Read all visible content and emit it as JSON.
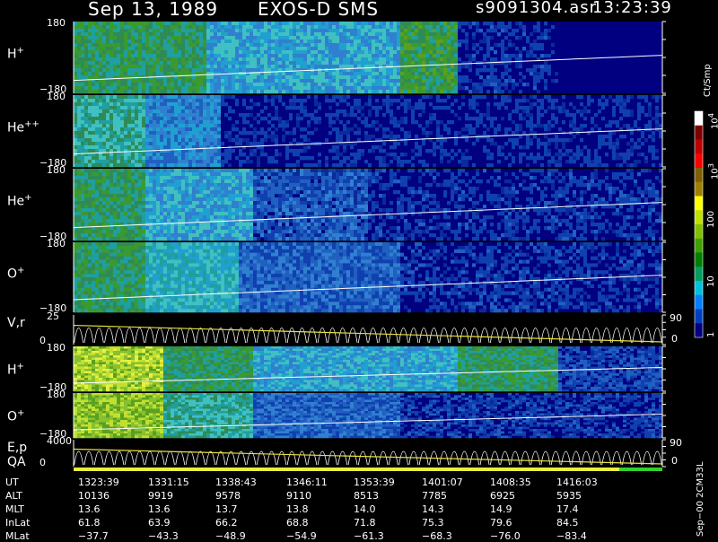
{
  "header": {
    "date": "Sep 13, 1989",
    "instrument": "EXOS-D SMS",
    "file": "s9091304.asr",
    "time": "13:23:39"
  },
  "chart_data": {
    "type": "heatmap",
    "panels": [
      {
        "label": "H",
        "charge": "+",
        "ymax": "180",
        "ymin": "−180"
      },
      {
        "label": "He",
        "charge": "++",
        "ymax": "180",
        "ymin": "−180"
      },
      {
        "label": "He",
        "charge": "+",
        "ymax": "180",
        "ymin": "−180"
      },
      {
        "label": "O",
        "charge": "+",
        "ymax": "180",
        "ymin": "−180"
      },
      {
        "label": "V,r",
        "charge": "",
        "ymax": "25",
        "ymin": "0",
        "rmax": "90",
        "rmin": "0"
      },
      {
        "label": "H",
        "charge": "+",
        "ymax": "180",
        "ymin": "−180"
      },
      {
        "label": "O",
        "charge": "+",
        "ymax": "180",
        "ymin": "−180"
      },
      {
        "label": "E,p",
        "charge": "",
        "ymax": "4000",
        "ymin": "0",
        "rmax": "90",
        "rmin": "0"
      }
    ],
    "qa_label": "QA",
    "colorbar": {
      "unit": "Ct/Smp",
      "ticks": [
        "1",
        "10",
        "100",
        "10",
        "10"
      ],
      "exponents": [
        "",
        "",
        "",
        "3",
        "4"
      ],
      "colors": [
        "#000080",
        "#0040c0",
        "#0080ff",
        "#00c0e0",
        "#00a060",
        "#008000",
        "#40a000",
        "#80c000",
        "#c0e000",
        "#ffff00",
        "#a08000",
        "#806000",
        "#ff0000",
        "#c00000",
        "#800000",
        "#ffffff"
      ]
    },
    "ephemeris": {
      "rows": [
        {
          "name": "UT",
          "values": [
            "1323:39",
            "1331:15",
            "1338:43",
            "1346:11",
            "1353:39",
            "1401:07",
            "1408:35",
            "1416:03"
          ]
        },
        {
          "name": "ALT",
          "values": [
            "10136",
            "9919",
            "9578",
            "9110",
            "8513",
            "7785",
            "6925",
            "5935"
          ]
        },
        {
          "name": "MLT",
          "values": [
            "13.6",
            "13.6",
            "13.7",
            "13.8",
            "14.0",
            "14.3",
            "14.9",
            "17.4"
          ]
        },
        {
          "name": "InLat",
          "values": [
            "61.8",
            "63.9",
            "66.2",
            "68.8",
            "71.8",
            "75.3",
            "79.6",
            "84.5"
          ]
        },
        {
          "name": "MLat",
          "values": [
            "−37.7",
            "−43.3",
            "−48.9",
            "−54.9",
            "−61.3",
            "−68.3",
            "−76.0",
            "−83.4"
          ]
        }
      ]
    }
  },
  "side_note": "Sep−00 2CM33L"
}
